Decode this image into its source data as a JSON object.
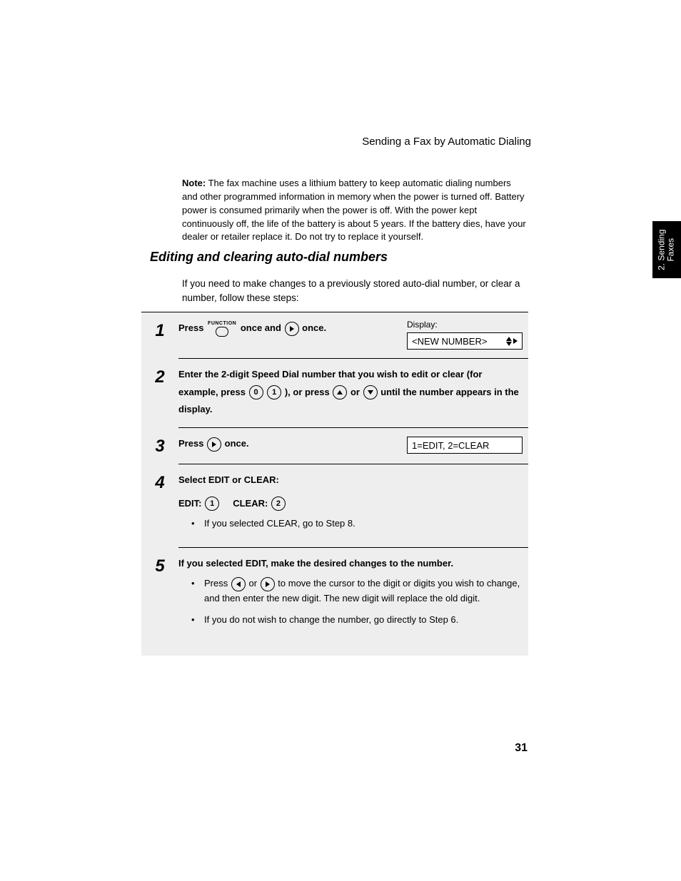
{
  "running_head": "Sending a Fax by Automatic Dialing",
  "side_tab": {
    "line1": "2. Sending",
    "line2": "Faxes"
  },
  "note": {
    "label": "Note:",
    "text": "The fax machine uses a lithium battery to keep automatic dialing numbers and other programmed information in memory when the power is turned off. Battery power is consumed primarily when the power is off. With the power kept continuously off, the life of the battery is about 5 years. If the battery dies, have your dealer or retailer replace it. Do not try to replace it yourself."
  },
  "section_title": "Editing and clearing auto-dial numbers",
  "intro": "If you need to make changes to a previously stored auto-dial number, or clear a number, follow these steps:",
  "steps": {
    "s1": {
      "num": "1",
      "press": "Press",
      "func_label": "FUNCTION",
      "once_and": "once and",
      "once_period": "once.",
      "display_label": "Display:",
      "lcd": "<NEW NUMBER>"
    },
    "s2": {
      "num": "2",
      "a": "Enter the 2-digit Speed Dial number that you wish to edit or clear (for example, press",
      "key0": "0",
      "key1": "1",
      "b": "), or press",
      "c": "or",
      "d": "until the number appears in the display."
    },
    "s3": {
      "num": "3",
      "press": "Press",
      "once": "once.",
      "lcd": "1=EDIT, 2=CLEAR"
    },
    "s4": {
      "num": "4",
      "title": "Select EDIT or CLEAR:",
      "edit_label": "EDIT:",
      "edit_key": "1",
      "clear_label": "CLEAR:",
      "clear_key": "2",
      "bullet": "If you selected CLEAR, go to Step 8."
    },
    "s5": {
      "num": "5",
      "title": "If you selected EDIT, make the desired changes to the number.",
      "b1a": "Press",
      "b1b": "or",
      "b1c": "to move the cursor to the digit or digits you wish to change, and then enter the new digit. The new digit will replace the old digit.",
      "b2": "If you do not wish to change the number, go directly to Step 6."
    }
  },
  "page_number": "31"
}
